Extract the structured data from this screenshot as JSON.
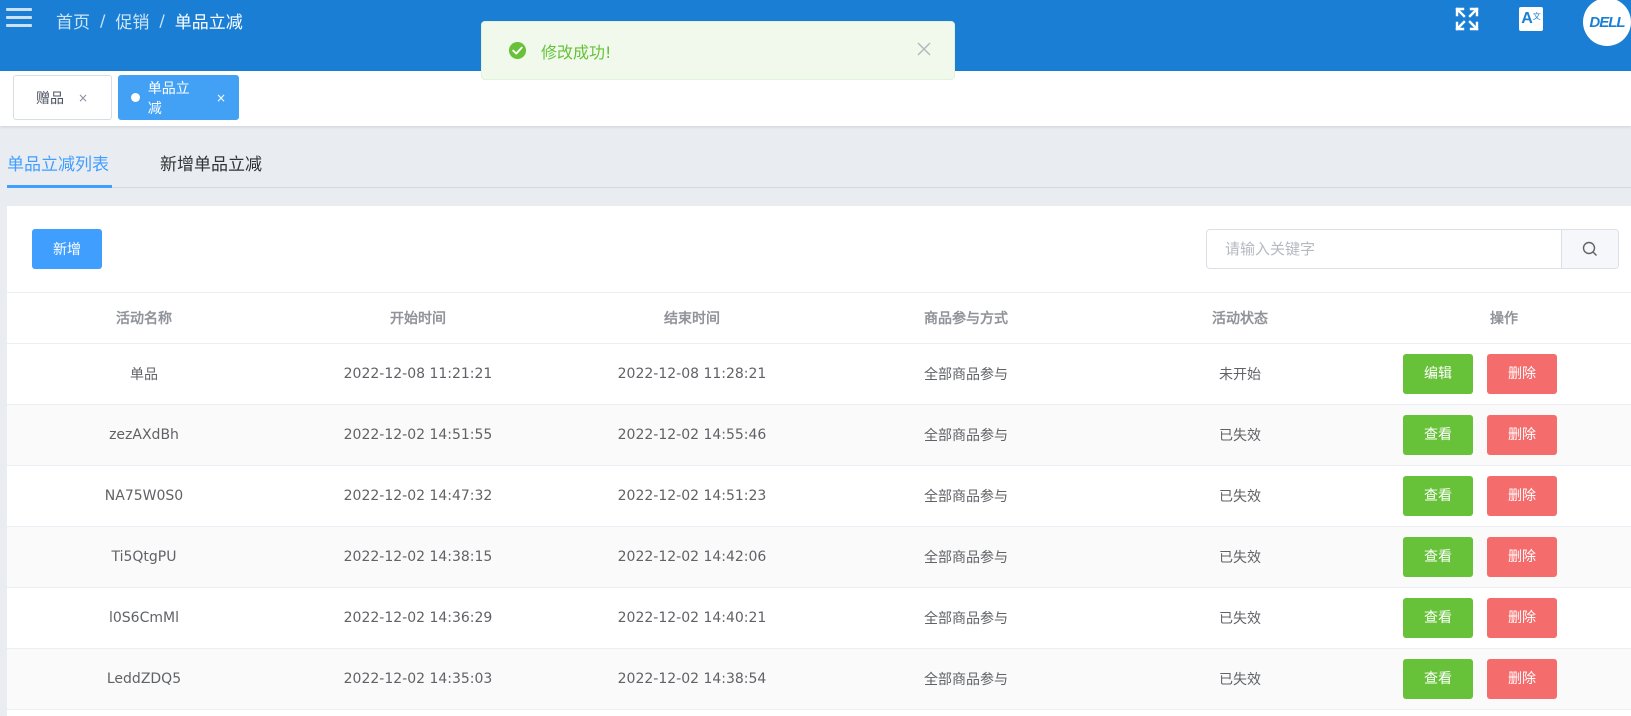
{
  "header": {
    "breadcrumb": [
      "首页",
      "促销",
      "单品立减"
    ],
    "sep": "/",
    "translate_label": "A",
    "translate_sup": "文",
    "avatar_text": "DELL",
    "bg_color": "#1a7fd4"
  },
  "tags": [
    {
      "label": "赠品",
      "close": "×",
      "active": false
    },
    {
      "label": "单品立减",
      "close": "×",
      "active": true
    }
  ],
  "subtabs": {
    "list": "单品立减列表",
    "add": "新增单品立减"
  },
  "toolbar": {
    "add_label": "新增",
    "search_placeholder": "请输入关键字"
  },
  "table": {
    "headers": [
      "活动名称",
      "开始时间",
      "结束时间",
      "商品参与方式",
      "活动状态",
      "操作"
    ],
    "rows": [
      {
        "name": "单品",
        "start": "2022-12-08 11:21:21",
        "end": "2022-12-08 11:28:21",
        "mode": "全部商品参与",
        "status": "未开始",
        "action": "编辑",
        "delete": "删除"
      },
      {
        "name": "zezAXdBh",
        "start": "2022-12-02 14:51:55",
        "end": "2022-12-02 14:55:46",
        "mode": "全部商品参与",
        "status": "已失效",
        "action": "查看",
        "delete": "删除"
      },
      {
        "name": "NA75W0S0",
        "start": "2022-12-02 14:47:32",
        "end": "2022-12-02 14:51:23",
        "mode": "全部商品参与",
        "status": "已失效",
        "action": "查看",
        "delete": "删除"
      },
      {
        "name": "Ti5QtgPU",
        "start": "2022-12-02 14:38:15",
        "end": "2022-12-02 14:42:06",
        "mode": "全部商品参与",
        "status": "已失效",
        "action": "查看",
        "delete": "删除"
      },
      {
        "name": "l0S6CmMl",
        "start": "2022-12-02 14:36:29",
        "end": "2022-12-02 14:40:21",
        "mode": "全部商品参与",
        "status": "已失效",
        "action": "查看",
        "delete": "删除"
      },
      {
        "name": "LeddZDQ5",
        "start": "2022-12-02 14:35:03",
        "end": "2022-12-02 14:38:54",
        "mode": "全部商品参与",
        "status": "已失效",
        "action": "查看",
        "delete": "删除"
      }
    ]
  },
  "toast": {
    "message": "修改成功!",
    "color": "#67c23a"
  }
}
